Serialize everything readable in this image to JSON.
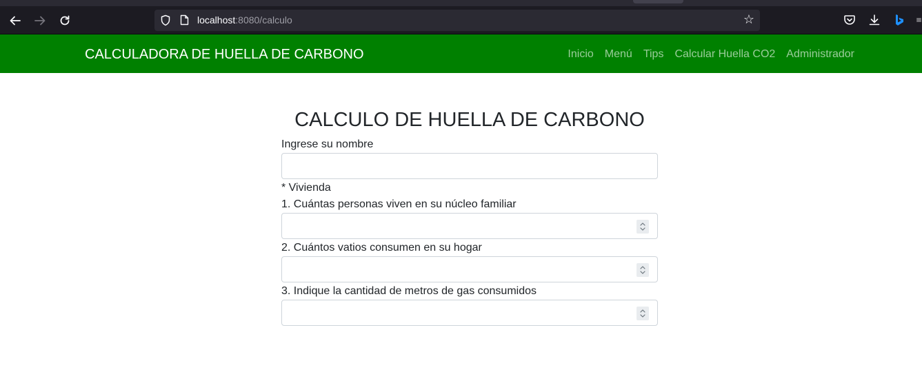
{
  "browser": {
    "url_host": "localhost",
    "url_path": ":8080/calculo"
  },
  "navbar": {
    "brand": "CALCULADORA DE HUELLA DE CARBONO",
    "links": [
      "Inicio",
      "Menú",
      "Tips",
      "Calcular Huella CO2",
      "Administrador"
    ],
    "background": "#008000"
  },
  "form": {
    "title": "CALCULO DE HUELLA DE CARBONO",
    "name_label": "Ingrese su nombre",
    "name_value": "",
    "section_label": "* Vivienda",
    "q1_label": "1. Cuántas personas viven en su núcleo familiar",
    "q1_value": "",
    "q2_label": "2. Cuántos vatios consumen en su hogar",
    "q2_value": "",
    "q3_label": "3. Indique la cantidad de metros de gas consumidos",
    "q3_value": ""
  }
}
